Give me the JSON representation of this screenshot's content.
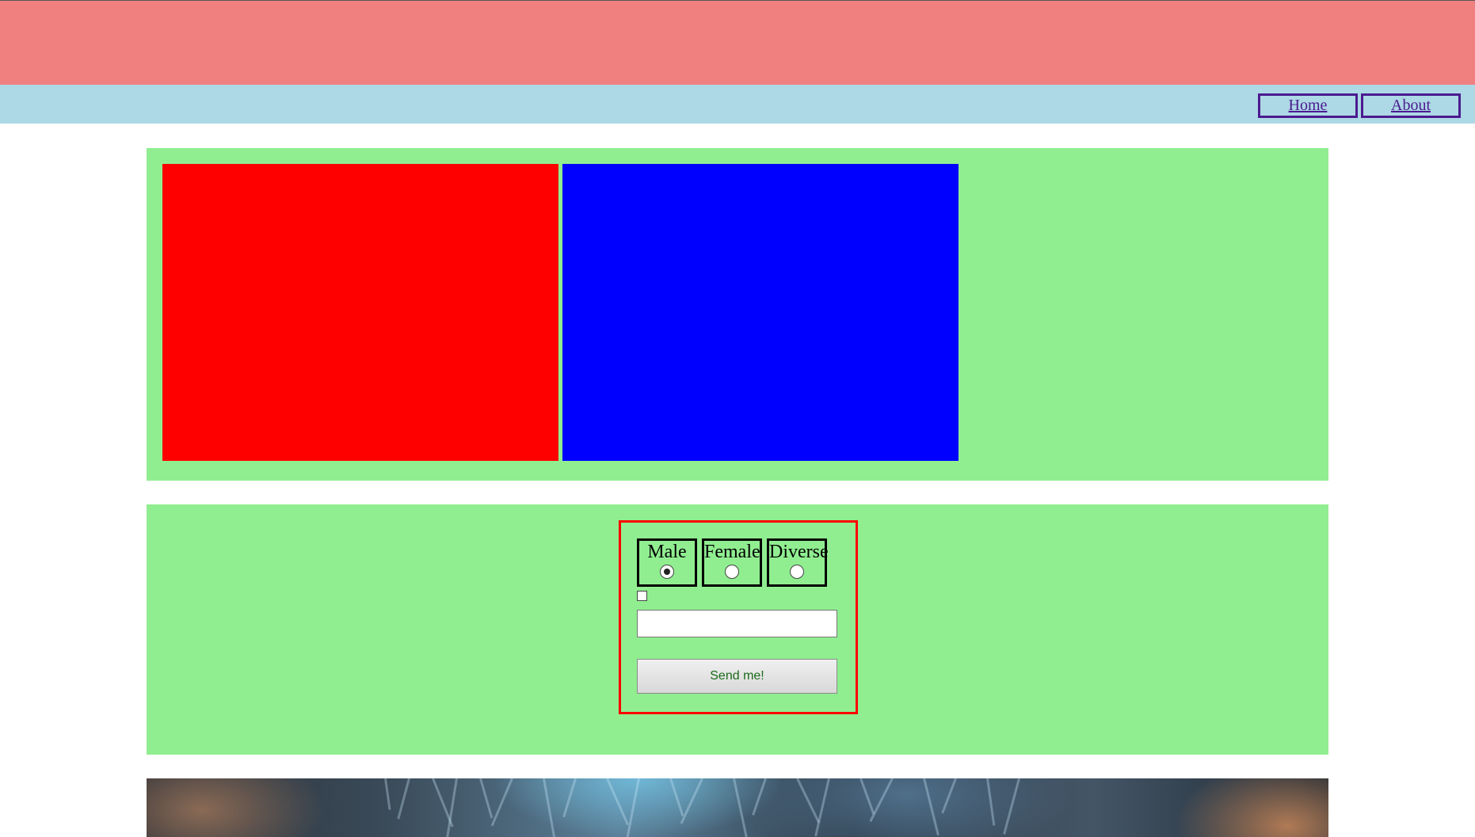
{
  "nav": {
    "home_label": "Home",
    "about_label": "About"
  },
  "colors": {
    "banner": "#f08080",
    "navbar": "#add8e6",
    "section_bg": "#90ee90",
    "red_box": "#ff0000",
    "blue_box": "#0000ff",
    "form_border": "#ff0000"
  },
  "form": {
    "radios": [
      {
        "label": "Male",
        "checked": true
      },
      {
        "label": "Female",
        "checked": false
      },
      {
        "label": "Diverse",
        "checked": false
      }
    ],
    "checkbox_checked": false,
    "text_input_value": "",
    "submit_label": "Send me!"
  }
}
